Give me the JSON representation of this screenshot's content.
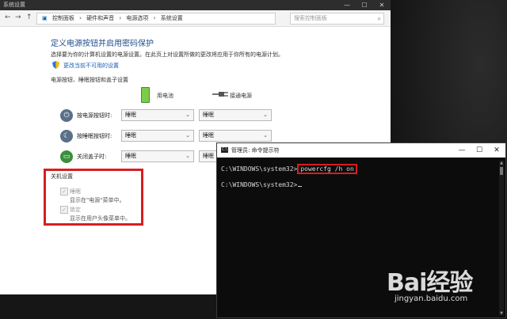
{
  "cp_window": {
    "title": "系统设置",
    "controls": [
      "—",
      "☐",
      "✕"
    ],
    "nav": [
      "←",
      "→",
      "↑"
    ],
    "breadcrumb": [
      "控制面板",
      "›",
      "硬件和声音",
      "›",
      "电源选项",
      "›",
      "系统设置"
    ],
    "search_placeholder": "搜索控制面板",
    "heading": "定义电源按钮并启用密码保护",
    "description": "选择要为你的计算机设置的电源设置。在此页上对设置所做的更改将应用于你所有的电源计划。",
    "change_link": "更改当前不可用的设置",
    "section_title": "电源按钮、睡眠按钮和盖子设置",
    "col_battery": "用电池",
    "col_plugged": "接通电源",
    "rows": [
      {
        "label": "按电源按钮时:",
        "battery": "睡眠",
        "plugged": "睡眠"
      },
      {
        "label": "按睡眠按钮时:",
        "battery": "睡眠",
        "plugged": "睡眠"
      },
      {
        "label": "关闭盖子时:",
        "battery": "睡眠",
        "plugged": "睡眠"
      }
    ],
    "shutdown_title": "关机设置",
    "shutdown_items": [
      {
        "label": "睡眠",
        "desc": "显示在\"电源\"菜单中。",
        "checked": true
      },
      {
        "label": "锁定",
        "desc": "显示在用户头像菜单中。",
        "checked": true
      }
    ]
  },
  "cmd_window": {
    "title": "管理员: 命令提示符",
    "controls": [
      "—",
      "☐",
      "✕"
    ],
    "line1_prompt": "C:\\WINDOWS\\system32>",
    "line1_command": "powercfg /h on",
    "line2_prompt": "C:\\WINDOWS\\system32>"
  },
  "watermark": {
    "logo": "Bai经验",
    "url": "jingyan.baidu.com"
  },
  "colors": {
    "highlight_red": "#d81e1e",
    "heading_blue": "#1f4e8c",
    "link_blue": "#1a5fb4"
  }
}
